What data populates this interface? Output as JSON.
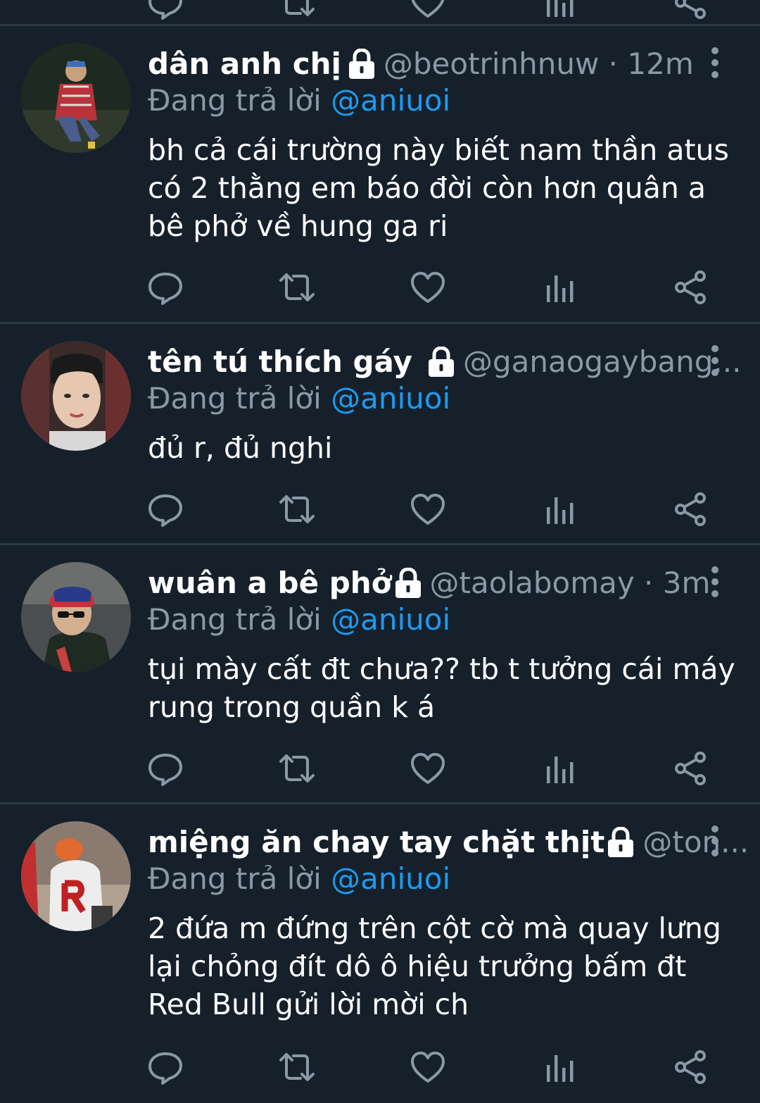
{
  "tweets": [
    {
      "display_name": "dân anh chị",
      "handle_time": "@beotrinhnuw · 12m",
      "reply_prefix": "Đang trả lời",
      "reply_to": "@aniuoi",
      "text_lines": [
        "bh cả cái trường này biết nam thần atus",
        "có 2 thằng em báo đời còn hơn quân a",
        "bê phở về hung ga ri"
      ]
    },
    {
      "display_name": "tên tú thích gáy",
      "handle_time": "@ganaogaybang...",
      "reply_prefix": "Đang trả lời",
      "reply_to": "@aniuoi",
      "text_lines": [
        "đủ r, đủ nghi"
      ]
    },
    {
      "display_name": "wuân a bê phở",
      "handle_time": "@taolabomay · 3m",
      "reply_prefix": "Đang trả lời",
      "reply_to": "@aniuoi",
      "text_lines": [
        "tụi mày cất đt chưa?? tb t tưởng cái máy",
        "rung trong quần k á"
      ]
    },
    {
      "display_name": "miệng ăn chay tay chặt thịt",
      "handle_time": "@ton...",
      "reply_prefix": "Đang trả lời",
      "reply_to": "@aniuoi",
      "text_lines": [
        "2 đứa m đứng trên cột cờ mà quay lưng",
        "lại chỏng đít dô ô hiệu trưởng bấm đt",
        "Red Bull gửi lời mời ch"
      ]
    }
  ],
  "icons": {
    "reply": "reply-icon",
    "retweet": "retweet-icon",
    "like": "heart-icon",
    "views": "views-icon",
    "share": "share-icon",
    "more": "more-vertical-icon",
    "lock": "lock-icon"
  },
  "colors": {
    "background": "#15202b",
    "divider": "#2c3843",
    "secondary_text": "#8b98a5",
    "mention": "#1d9bf0",
    "icon": "#8b98a5"
  }
}
